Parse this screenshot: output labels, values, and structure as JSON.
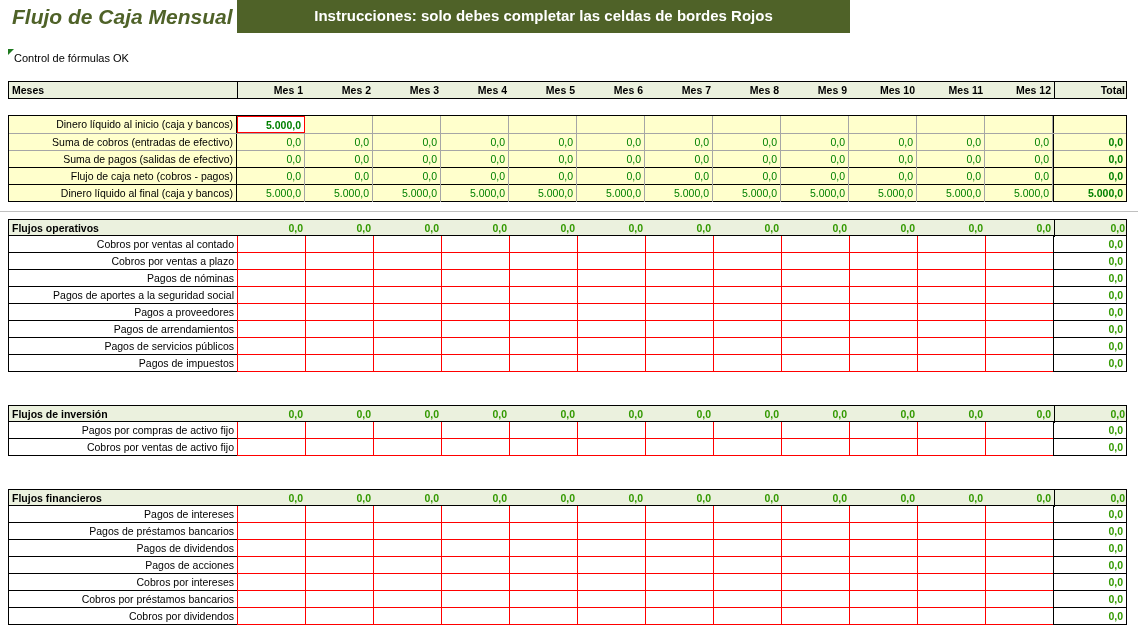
{
  "title": "Flujo de Caja Mensual",
  "instructions": "Instrucciones: solo debes completar las celdas de bordes Rojos",
  "formula_check": "Control de fórmulas OK",
  "header": {
    "label": "Meses",
    "months": [
      "Mes 1",
      "Mes 2",
      "Mes 3",
      "Mes 4",
      "Mes 5",
      "Mes 6",
      "Mes 7",
      "Mes 8",
      "Mes 9",
      "Mes 10",
      "Mes 11",
      "Mes 12"
    ],
    "total": "Total"
  },
  "summary": [
    {
      "kind": "input",
      "label": "Dinero líquido al inicio (caja y bancos)",
      "values": [
        "5.000,0"
      ]
    },
    {
      "kind": "formula",
      "label": "Suma de cobros (entradas de efectivo)",
      "values": [
        "0,0",
        "0,0",
        "0,0",
        "0,0",
        "0,0",
        "0,0",
        "0,0",
        "0,0",
        "0,0",
        "0,0",
        "0,0",
        "0,0"
      ],
      "total": "0,0"
    },
    {
      "kind": "formula",
      "label": "Suma de pagos (salidas de efectivo)",
      "values": [
        "0,0",
        "0,0",
        "0,0",
        "0,0",
        "0,0",
        "0,0",
        "0,0",
        "0,0",
        "0,0",
        "0,0",
        "0,0",
        "0,0"
      ],
      "total": "0,0"
    },
    {
      "kind": "formula",
      "label": "Flujo de caja neto (cobros - pagos)",
      "values": [
        "0,0",
        "0,0",
        "0,0",
        "0,0",
        "0,0",
        "0,0",
        "0,0",
        "0,0",
        "0,0",
        "0,0",
        "0,0",
        "0,0"
      ],
      "total": "0,0"
    },
    {
      "kind": "formula",
      "label": "Dinero líquido al final (caja y bancos)",
      "values": [
        "5.000,0",
        "5.000,0",
        "5.000,0",
        "5.000,0",
        "5.000,0",
        "5.000,0",
        "5.000,0",
        "5.000,0",
        "5.000,0",
        "5.000,0",
        "5.000,0",
        "5.000,0"
      ],
      "total": "5.000,0"
    }
  ],
  "sections": [
    {
      "title": "Flujos operativos",
      "values": [
        "0,0",
        "0,0",
        "0,0",
        "0,0",
        "0,0",
        "0,0",
        "0,0",
        "0,0",
        "0,0",
        "0,0",
        "0,0",
        "0,0"
      ],
      "total": "0,0",
      "rows": [
        {
          "label": "Cobros por ventas al contado",
          "total": "0,0"
        },
        {
          "label": "Cobros por ventas a plazo",
          "total": "0,0"
        },
        {
          "label": "Pagos de nóminas",
          "total": "0,0"
        },
        {
          "label": "Pagos de aportes a la seguridad social",
          "total": "0,0"
        },
        {
          "label": "Pagos a proveedores",
          "total": "0,0"
        },
        {
          "label": "Pagos de arrendamientos",
          "total": "0,0"
        },
        {
          "label": "Pagos de servicios públicos",
          "total": "0,0"
        },
        {
          "label": "Pagos de impuestos",
          "total": "0,0"
        }
      ]
    },
    {
      "title": "Flujos de inversión",
      "values": [
        "0,0",
        "0,0",
        "0,0",
        "0,0",
        "0,0",
        "0,0",
        "0,0",
        "0,0",
        "0,0",
        "0,0",
        "0,0",
        "0,0"
      ],
      "total": "0,0",
      "rows": [
        {
          "label": "Pagos por compras de activo fijo",
          "total": "0,0"
        },
        {
          "label": "Cobros por ventas de activo fijo",
          "total": "0,0"
        }
      ]
    },
    {
      "title": "Flujos financieros",
      "values": [
        "0,0",
        "0,0",
        "0,0",
        "0,0",
        "0,0",
        "0,0",
        "0,0",
        "0,0",
        "0,0",
        "0,0",
        "0,0",
        "0,0"
      ],
      "total": "0,0",
      "rows": [
        {
          "label": "Pagos de intereses",
          "total": "0,0"
        },
        {
          "label": "Pagos de préstamos bancarios",
          "total": "0,0"
        },
        {
          "label": "Pagos de dividendos",
          "total": "0,0"
        },
        {
          "label": "Pagos de acciones",
          "total": "0,0"
        },
        {
          "label": "Cobros por intereses",
          "total": "0,0"
        },
        {
          "label": "Cobros por préstamos bancarios",
          "total": "0,0"
        },
        {
          "label": "Cobros por dividendos",
          "total": "0,0"
        }
      ]
    }
  ]
}
